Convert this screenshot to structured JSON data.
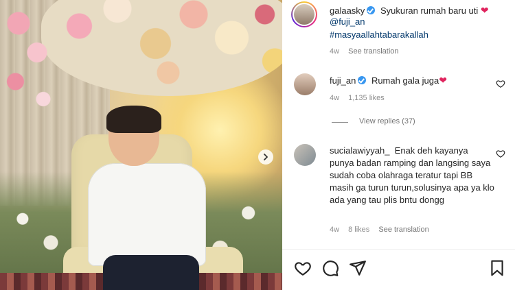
{
  "post": {
    "author": {
      "username": "galaasky",
      "verified": true
    },
    "caption": "Syukuran rumah baru uti",
    "caption_emoji": "❤",
    "mention": "@fuji_an",
    "hashtag": "#masyaallahtabarakallah",
    "time": "4w",
    "see_translation": "See translation"
  },
  "comments": [
    {
      "username": "fuji_an",
      "verified": true,
      "text": "Rumah gala juga",
      "emoji": "❤",
      "time": "4w",
      "likes": "1,135 likes",
      "view_replies": "View replies (37)"
    },
    {
      "username": "sucialawiyyah_",
      "verified": false,
      "text": "Enak deh kayanya punya badan ramping dan langsing saya sudah coba olahraga teratur tapi BB masih ga turun turun,solusinya apa ya klo ada yang tau plis bntu dongg",
      "time": "4w",
      "likes": "8 likes",
      "see_translation": "See translation"
    }
  ],
  "icons": {
    "like": "heart-outline-icon",
    "comment": "comment-icon",
    "share": "paper-plane-icon",
    "save": "bookmark-icon",
    "next": "chevron-right-icon"
  },
  "colors": {
    "link": "#00376b",
    "muted": "#8e8e8e",
    "verified": "#3897f0",
    "heart": "#e0245e"
  }
}
